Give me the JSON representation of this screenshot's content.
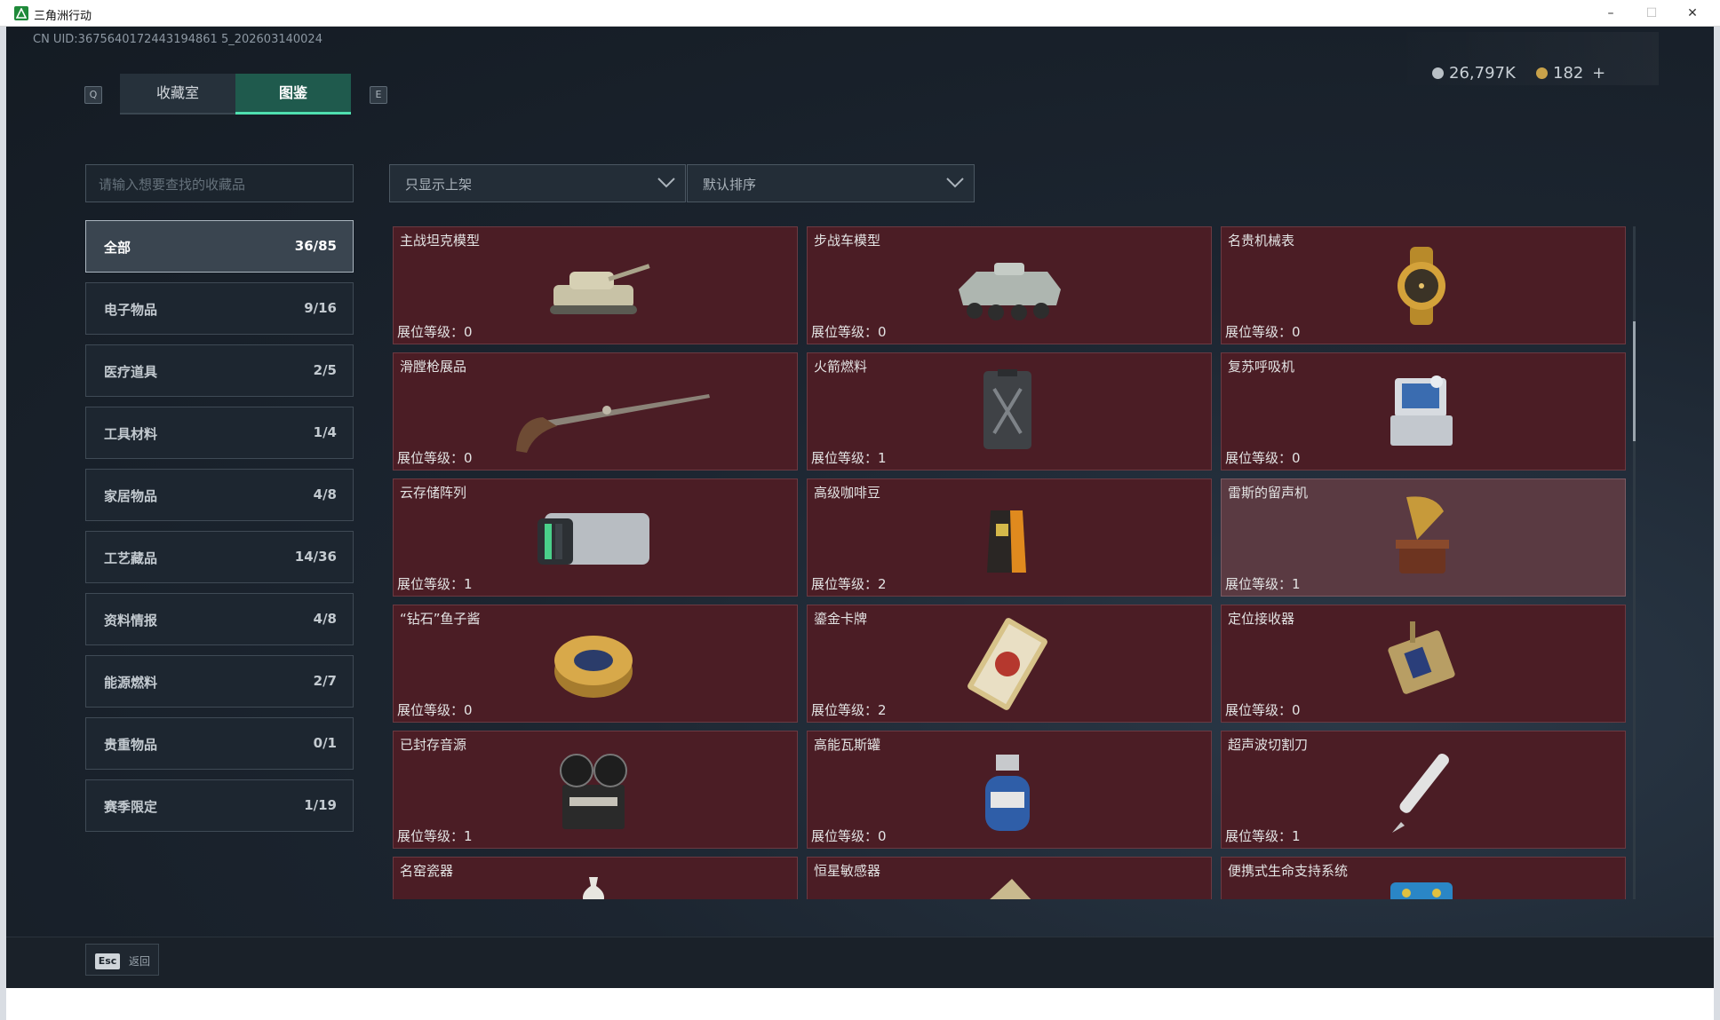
{
  "window": {
    "title": "三角洲行动",
    "minimize": "–",
    "maximize": "☐",
    "close": "✕"
  },
  "uid": "CN UID:3675640172443194861 5_202603140024",
  "currency": {
    "silver": "26,797K",
    "gold": "182",
    "gold_add": "+",
    "silver_color": "#b9c0c6",
    "gold_color": "#c8a24a"
  },
  "tabs": {
    "prev_key": "Q",
    "next_key": "E",
    "items": [
      {
        "label": "收藏室",
        "active": false
      },
      {
        "label": "图鉴",
        "active": true
      }
    ]
  },
  "search": {
    "placeholder": "请输入想要查找的收藏品"
  },
  "filters": {
    "filter_label": "只显示上架",
    "sort_label": "默认排序"
  },
  "categories": [
    {
      "name": "全部",
      "count": "36/85",
      "active": true
    },
    {
      "name": "电子物品",
      "count": "9/16"
    },
    {
      "name": "医疗道具",
      "count": "2/5"
    },
    {
      "name": "工具材料",
      "count": "1/4"
    },
    {
      "name": "家居物品",
      "count": "4/8"
    },
    {
      "name": "工艺藏品",
      "count": "14/36"
    },
    {
      "name": "资料情报",
      "count": "4/8"
    },
    {
      "name": "能源燃料",
      "count": "2/7"
    },
    {
      "name": "贵重物品",
      "count": "0/1"
    },
    {
      "name": "赛季限定",
      "count": "1/19"
    }
  ],
  "level_prefix": "展位等级：",
  "items": [
    {
      "name": "主战坦克模型",
      "level": "0",
      "icon": "tank-icon"
    },
    {
      "name": "步战车模型",
      "level": "0",
      "icon": "ifv-icon"
    },
    {
      "name": "名贵机械表",
      "level": "0",
      "icon": "watch-icon"
    },
    {
      "name": "滑膛枪展品",
      "level": "0",
      "icon": "musket-icon"
    },
    {
      "name": "火箭燃料",
      "level": "1",
      "icon": "fuel-can-icon"
    },
    {
      "name": "复苏呼吸机",
      "level": "0",
      "icon": "ventilator-icon"
    },
    {
      "name": "云存储阵列",
      "level": "1",
      "icon": "storage-array-icon"
    },
    {
      "name": "高级咖啡豆",
      "level": "2",
      "icon": "coffee-bag-icon"
    },
    {
      "name": "雷斯的留声机",
      "level": "1",
      "icon": "gramophone-icon",
      "highlight": true
    },
    {
      "name": "“钻石”鱼子酱",
      "level": "0",
      "icon": "caviar-tin-icon"
    },
    {
      "name": "鎏金卡牌",
      "level": "2",
      "icon": "gold-card-icon"
    },
    {
      "name": "定位接收器",
      "level": "0",
      "icon": "gps-receiver-icon"
    },
    {
      "name": "已封存音源",
      "level": "1",
      "icon": "reel-recorder-icon"
    },
    {
      "name": "高能瓦斯罐",
      "level": "0",
      "icon": "gas-canister-icon"
    },
    {
      "name": "超声波切割刀",
      "level": "1",
      "icon": "ultrasonic-cutter-icon"
    },
    {
      "name": "名窑瓷器",
      "level": "",
      "icon": "porcelain-icon"
    },
    {
      "name": "恒星敏感器",
      "level": "",
      "icon": "star-sensor-icon"
    },
    {
      "name": "便携式生命支持系统",
      "level": "",
      "icon": "life-support-icon"
    }
  ],
  "footer": {
    "esc_key": "Esc",
    "back_label": "返回"
  }
}
